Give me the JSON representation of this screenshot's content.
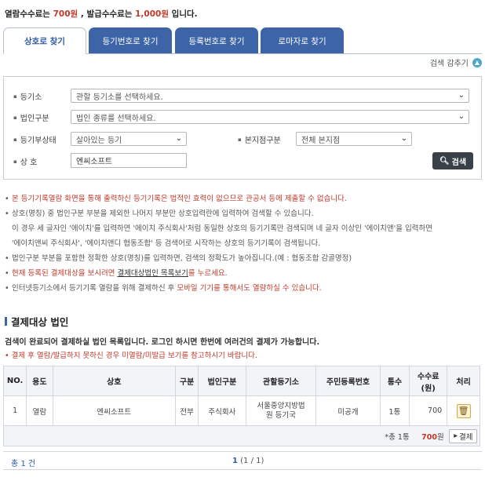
{
  "fee": {
    "prefix": "열람수수료는 ",
    "view_fee": "700원",
    "middle": " , 발급수수료는 ",
    "issue_fee": "1,000원",
    "suffix": " 입니다."
  },
  "tabs": [
    {
      "label": "상호로 찾기",
      "active": true
    },
    {
      "label": "등기번호로 찾기"
    },
    {
      "label": "등록번호로 찾기"
    },
    {
      "label": "로마자로 찾기"
    }
  ],
  "hide_search": {
    "label": "검색 감추기",
    "icon": "chevron-up-icon"
  },
  "search": {
    "registry_label": "등기소",
    "registry_value": "관할 등기소를 선택하세요.",
    "corp_type_label": "법인구분",
    "corp_type_value": "법인 종류를 선택하세요.",
    "status_label": "등기부상태",
    "status_value": "살아있는 등기",
    "branch_label": "본지점구분",
    "branch_value": "전체 본지점",
    "name_label": "상 호",
    "name_value": "엔씨소프트",
    "search_button": "검색"
  },
  "notes": [
    {
      "text": "본 등기기록열람 화면을 통해 출력하신 등기기록은 법적인 효력이 없으므로 관공서 등에 제출할 수 없습니다.",
      "red": true
    },
    {
      "text": "상호(명칭) 중 법인구분 부분을 제외한 나머지 부분만 상호입력란에 입력하여 검색할 수 있습니다."
    },
    {
      "text": "이 경우 세 글자인 '에이치'를 입력하면 '에이치 주식회사'처럼 동일한 상호의 등기기록만 검색되며 네 글자 이상인 '에이치앤'을 입력하면",
      "cont": true
    },
    {
      "text": "'에이치앤씨 주식회사', '에이치앤디 협동조합' 등 검색어로 시작하는 상호의 등기기록이 검색됩니다.",
      "cont": true
    },
    {
      "text": "법인구분 부분을 포함한 정확한 상호(명칭)를 입력하면, 검색의 정확도가 높아집니다.(예 : 협동조합 감골명정)"
    }
  ],
  "note_paid": {
    "before": "현재 등록된 결제대상을 보시려면 ",
    "link": "결제대상법인 목록보기",
    "after": "를 누르세요."
  },
  "note_mobile": {
    "before": "인터넷등기소에서 등기기록 열람을 위해 결제하신 후 ",
    "red": "모바일 기기를 통해서도 열람하실 수 있습니다."
  },
  "section": {
    "title": "결제대상 법인",
    "desc": "검색이 완료되어 결제하실 법인 목록입니다. 로그인 하시면 한번에 여러건의 결제가 가능합니다.",
    "warn": "• 결제 후 열람/발급하지 못하신 경우 미열람/미발급 보기를 참고하시기 바랍니다."
  },
  "table": {
    "headers": [
      "NO.",
      "용도",
      "상호",
      "구분",
      "법인구분",
      "관할등기소",
      "주민등록번호",
      "통수",
      "수수료\n(원)",
      "처리"
    ],
    "rows": [
      {
        "no": "1",
        "use": "열람",
        "name": "엔씨소프트",
        "kind": "전부",
        "corp": "주식회사",
        "office": "서울중앙지방법\n원 등기국",
        "rrn": "미공개",
        "count": "1통",
        "fee": "700"
      }
    ],
    "sum_count": "*총 1통",
    "sum_fee": "700",
    "sum_fee_unit": "원",
    "pay_button": "결제"
  },
  "footer": {
    "total": "총 1 건",
    "page_current": "1",
    "page_info": "(1 / 1)"
  }
}
